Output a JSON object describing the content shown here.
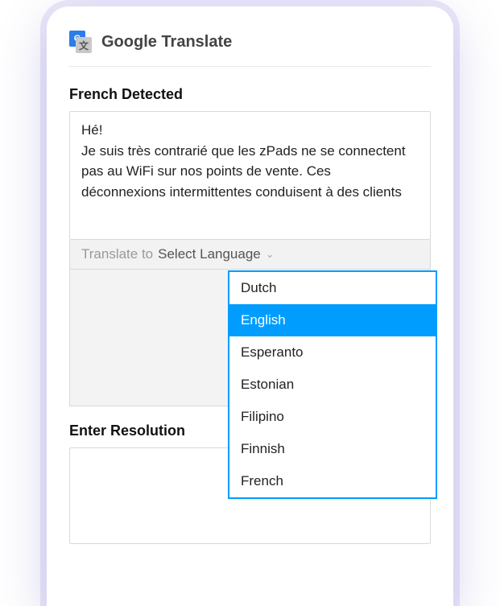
{
  "header": {
    "icon_primary_letter": "G",
    "icon_secondary_letter": "文",
    "title": "Google Translate"
  },
  "detect": {
    "heading": "French Detected"
  },
  "source_text": "Hé!\nJe suis très contrarié que les zPads ne se connectent pas au WiFi sur nos points de vente. Ces déconnexions intermittentes conduisent à des clients",
  "translate_to": {
    "label": "Translate to",
    "placeholder": "Select Language",
    "options": [
      {
        "label": "Dutch",
        "selected": false
      },
      {
        "label": "English",
        "selected": true
      },
      {
        "label": "Esperanto",
        "selected": false
      },
      {
        "label": "Estonian",
        "selected": false
      },
      {
        "label": "Filipino",
        "selected": false
      },
      {
        "label": "Finnish",
        "selected": false
      },
      {
        "label": "French",
        "selected": false
      }
    ]
  },
  "resolution": {
    "heading": "Enter Resolution"
  }
}
